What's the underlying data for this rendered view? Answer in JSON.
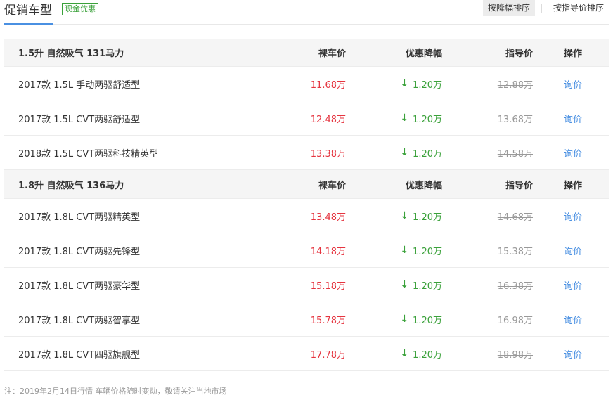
{
  "header": {
    "title": "促销车型",
    "badge": "现金优惠",
    "sort_options": [
      "按降幅排序",
      "按指导价排序"
    ]
  },
  "columns": {
    "price": "裸车价",
    "discount": "优惠降幅",
    "guide": "指导价",
    "action": "操作"
  },
  "groups": [
    {
      "name": "1.5升 自然吸气 131马力",
      "items": [
        {
          "name": "2017款 1.5L 手动两驱舒适型",
          "price": "11.68万",
          "discount": "1.20万",
          "guide": "12.88万",
          "action": "询价"
        },
        {
          "name": "2017款 1.5L CVT两驱舒适型",
          "price": "12.48万",
          "discount": "1.20万",
          "guide": "13.68万",
          "action": "询价"
        },
        {
          "name": "2018款 1.5L CVT两驱科技精英型",
          "price": "13.38万",
          "discount": "1.20万",
          "guide": "14.58万",
          "action": "询价"
        }
      ]
    },
    {
      "name": "1.8升 自然吸气 136马力",
      "items": [
        {
          "name": "2017款 1.8L CVT两驱精英型",
          "price": "13.48万",
          "discount": "1.20万",
          "guide": "14.68万",
          "action": "询价"
        },
        {
          "name": "2017款 1.8L CVT两驱先锋型",
          "price": "14.18万",
          "discount": "1.20万",
          "guide": "15.38万",
          "action": "询价"
        },
        {
          "name": "2017款 1.8L CVT两驱豪华型",
          "price": "15.18万",
          "discount": "1.20万",
          "guide": "16.38万",
          "action": "询价"
        },
        {
          "name": "2017款 1.8L CVT两驱智享型",
          "price": "15.78万",
          "discount": "1.20万",
          "guide": "16.98万",
          "action": "询价"
        },
        {
          "name": "2017款 1.8L CVT四驱旗舰型",
          "price": "17.78万",
          "discount": "1.20万",
          "guide": "18.98万",
          "action": "询价"
        }
      ]
    }
  ],
  "icons": {
    "discount_arrow": "arrow-down-icon"
  },
  "colors": {
    "price": "#e5343f",
    "discount": "#3aa13a",
    "link": "#4a90e2",
    "accent": "#4a90e2"
  },
  "note": "注：2019年2月14日行情 车辆价格随时变动，敬请关注当地市场"
}
